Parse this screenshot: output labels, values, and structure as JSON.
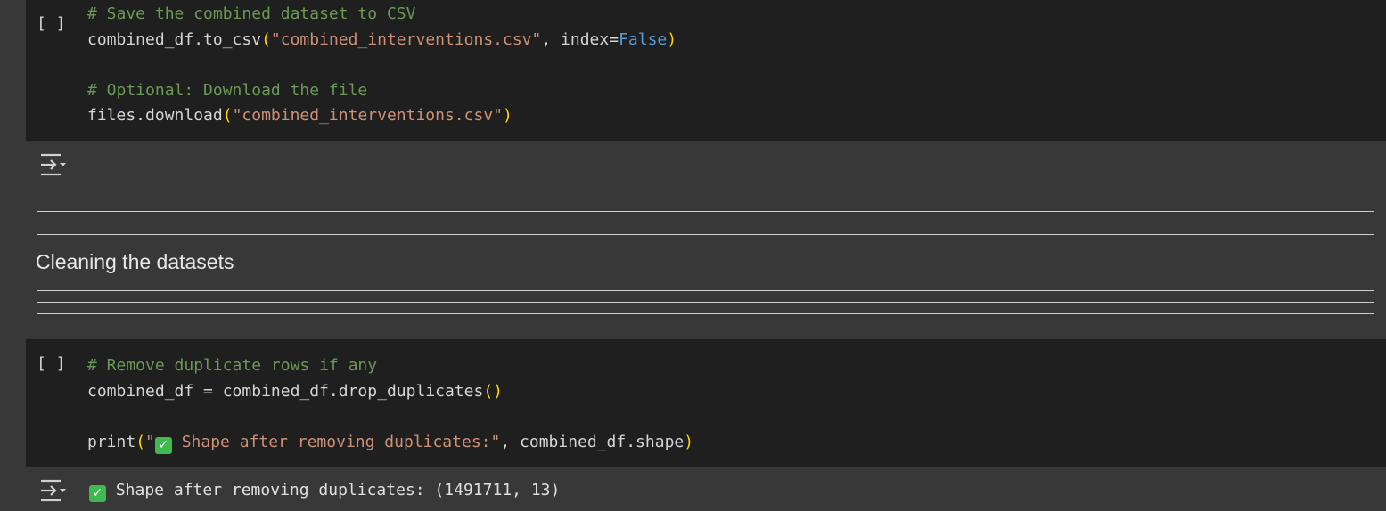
{
  "cell1": {
    "run_label": "[ ]",
    "lines": [
      [
        {
          "t": "comment",
          "v": "# Save the combined dataset to CSV"
        }
      ],
      [
        {
          "t": "text",
          "v": "combined_df.to_csv"
        },
        {
          "t": "paren",
          "v": "("
        },
        {
          "t": "string",
          "v": "\"combined_interventions.csv\""
        },
        {
          "t": "text",
          "v": ", index="
        },
        {
          "t": "const",
          "v": "False"
        },
        {
          "t": "paren",
          "v": ")"
        }
      ],
      [],
      [
        {
          "t": "comment",
          "v": "# Optional: Download the file"
        }
      ],
      [
        {
          "t": "text",
          "v": "files.download"
        },
        {
          "t": "paren",
          "v": "("
        },
        {
          "t": "string",
          "v": "\"combined_interventions.csv\""
        },
        {
          "t": "paren",
          "v": ")"
        }
      ]
    ]
  },
  "markdown": {
    "heading": "Cleaning the datasets"
  },
  "cell2": {
    "run_label": "[ ]",
    "lines": [
      [
        {
          "t": "comment",
          "v": "# Remove duplicate rows if any"
        }
      ],
      [
        {
          "t": "text",
          "v": "combined_df = combined_df.drop_duplicates"
        },
        {
          "t": "paren",
          "v": "()"
        }
      ],
      [],
      [
        {
          "t": "text",
          "v": "print"
        },
        {
          "t": "paren",
          "v": "("
        },
        {
          "t": "string",
          "v": "\""
        },
        {
          "t": "check",
          "v": "✓"
        },
        {
          "t": "string",
          "v": " Shape after removing duplicates:\""
        },
        {
          "t": "text",
          "v": ", combined_df.shape"
        },
        {
          "t": "paren",
          "v": ")"
        }
      ]
    ],
    "output": {
      "check": "✓",
      "text": " Shape after removing duplicates: (1491711, 13)"
    }
  },
  "icons": {
    "output_toggle": "output-collapse-icon",
    "check": "check-mark-icon"
  },
  "colors": {
    "code_bg": "#1f1f1f",
    "output_bg": "#383838",
    "comment": "#6a9955",
    "string": "#ce9178",
    "keyword_const": "#569cd6",
    "bracket": "#ffd700",
    "check_green": "#3fb950"
  }
}
